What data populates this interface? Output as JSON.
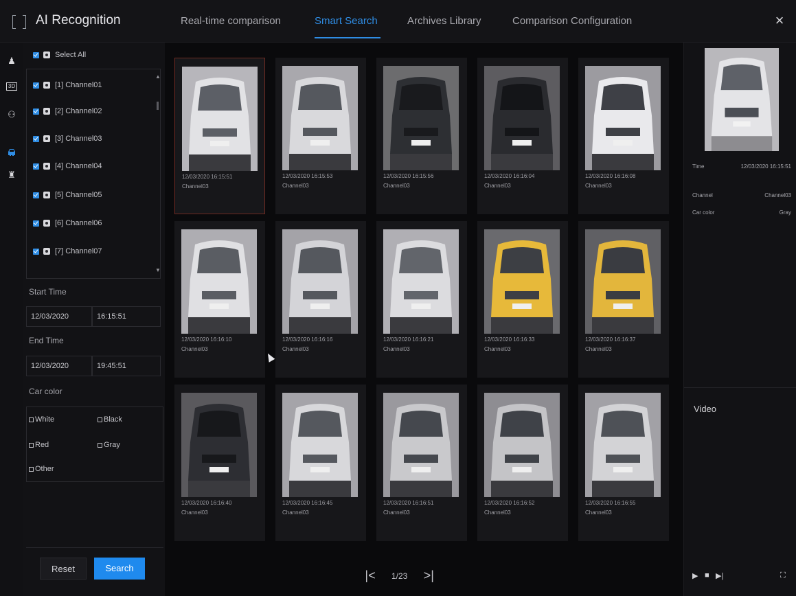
{
  "header": {
    "app_title": "AI Recognition",
    "tabs": [
      {
        "label": "Real-time comparison",
        "active": false
      },
      {
        "label": "Smart Search",
        "active": true
      },
      {
        "label": "Archives Library",
        "active": false
      },
      {
        "label": "Comparison Configuration",
        "active": false
      }
    ],
    "close_icon": "×"
  },
  "rail": {
    "icons": [
      {
        "name": "person-icon",
        "glyph": "♟",
        "active": false
      },
      {
        "name": "3d-icon",
        "glyph": "3D",
        "active": false
      },
      {
        "name": "face-compare-icon",
        "glyph": "⚇",
        "active": false
      },
      {
        "name": "car-icon",
        "glyph": "🚗",
        "active": true
      },
      {
        "name": "pedestrian-icon",
        "glyph": "♜",
        "active": false
      }
    ]
  },
  "filter": {
    "select_all": "Select All",
    "channels": [
      "[1] Channel01",
      "[2] Channel02",
      "[3] Channel03",
      "[4] Channel04",
      "[5] Channel05",
      "[6] Channel06",
      "[7] Channel07"
    ],
    "start_time_label": "Start Time",
    "start_date": "12/03/2020",
    "start_clock": "16:15:51",
    "end_time_label": "End Time",
    "end_date": "12/03/2020",
    "end_clock": "19:45:51",
    "car_color_label": "Car color",
    "colors": [
      "White",
      "Black",
      "Red",
      "Gray",
      "Other"
    ],
    "reset_label": "Reset",
    "search_label": "Search"
  },
  "results": [
    {
      "time": "12/03/2020 16:15:51",
      "channel": "Channel03"
    },
    {
      "time": "12/03/2020 16:15:53",
      "channel": "Channel03"
    },
    {
      "time": "12/03/2020 16:15:56",
      "channel": "Channel03"
    },
    {
      "time": "12/03/2020 16:16:04",
      "channel": "Channel03"
    },
    {
      "time": "12/03/2020 16:16:08",
      "channel": "Channel03"
    },
    {
      "time": "12/03/2020 16:16:10",
      "channel": "Channel03"
    },
    {
      "time": "12/03/2020 16:16:16",
      "channel": "Channel03"
    },
    {
      "time": "12/03/2020 16:16:21",
      "channel": "Channel03"
    },
    {
      "time": "12/03/2020 16:16:33",
      "channel": "Channel03"
    },
    {
      "time": "12/03/2020 16:16:37",
      "channel": "Channel03"
    },
    {
      "time": "12/03/2020 16:16:40",
      "channel": "Channel03"
    },
    {
      "time": "12/03/2020 16:16:45",
      "channel": "Channel03"
    },
    {
      "time": "12/03/2020 16:16:51",
      "channel": "Channel03"
    },
    {
      "time": "12/03/2020 16:16:52",
      "channel": "Channel03"
    },
    {
      "time": "12/03/2020 16:16:55",
      "channel": "Channel03"
    }
  ],
  "pager": {
    "first": "|<",
    "page": "1/23",
    "last": ">|"
  },
  "detail": {
    "time_label": "Time",
    "time_value": "12/03/2020 16:15:51",
    "channel_label": "Channel",
    "channel_value": "Channel03",
    "color_label": "Car color",
    "color_value": "Gray",
    "video_label": "Video",
    "controls": [
      "▶",
      "■",
      "▶|",
      "⛶"
    ]
  },
  "colors": {
    "accent": "#2f8de4",
    "search_button": "#1f8aee",
    "selected_border": "#6e2a22"
  }
}
